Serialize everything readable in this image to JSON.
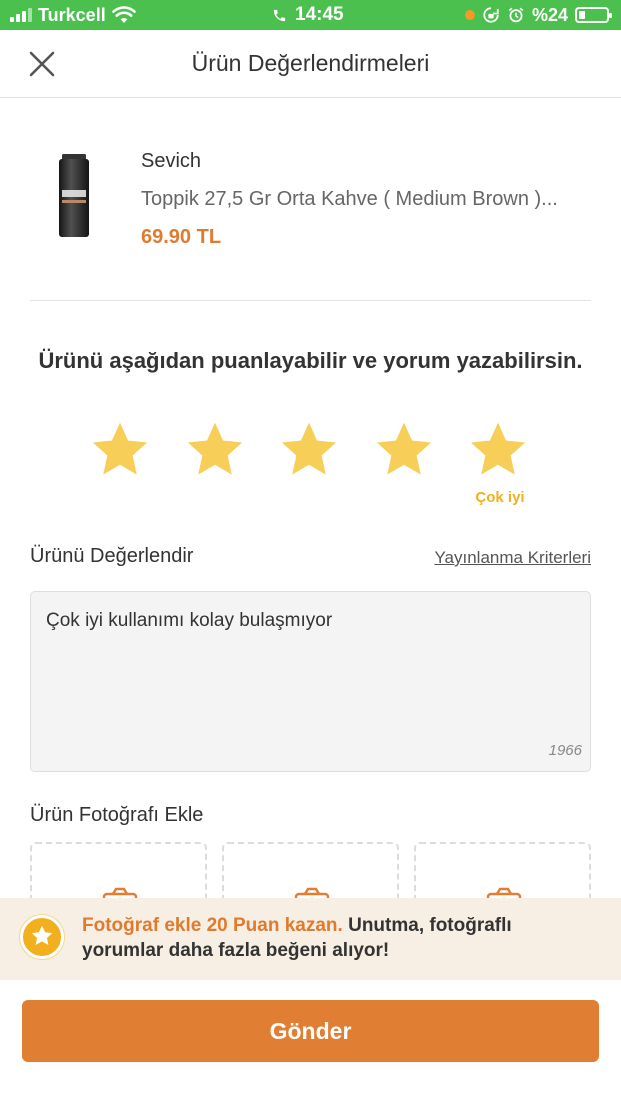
{
  "status_bar": {
    "carrier": "Turkcell",
    "time": "14:45",
    "battery_text": "%24",
    "battery_level": 0.24,
    "colors": {
      "bar": "#4cc04f",
      "dot": "#f39a2a"
    }
  },
  "header": {
    "title": "Ürün Değerlendirmeleri",
    "close_icon": "close-icon"
  },
  "product": {
    "brand": "Sevich",
    "name": "Toppik 27,5 Gr Orta Kahve ( Medium Brown )...",
    "price": "69.90 TL",
    "price_color": "#e07a2e"
  },
  "rating": {
    "prompt": "Ürünü aşağıdan puanlayabilir ve yorum yazabilirsin.",
    "value": 5,
    "max": 5,
    "label": "Çok iyi",
    "star_color": "#f7cf58"
  },
  "review": {
    "section_title": "Ürünü Değerlendir",
    "criteria_link": "Yayınlanma Kriterleri",
    "text": "Çok iyi kullanımı kolay bulaşmıyor",
    "remaining_chars": "1966"
  },
  "photos": {
    "section_title": "Ürün Fotoğrafı Ekle",
    "slots": 3,
    "icon": "camera-icon"
  },
  "banner": {
    "highlight": "Fotoğraf ekle 20 Puan kazan.",
    "message": " Unutma, fotoğraflı yorumlar daha fazla beğeni alıyor!",
    "icon": "star-badge-icon",
    "background": "#f7efe3"
  },
  "submit": {
    "label": "Gönder",
    "color": "#e07f33"
  }
}
